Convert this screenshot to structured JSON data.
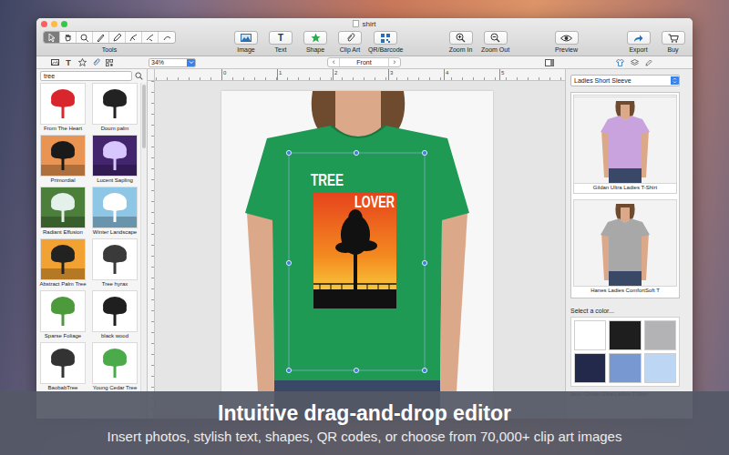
{
  "window": {
    "title": "shirt"
  },
  "toolbar": {
    "tools_label": "Tools",
    "tools": [
      {
        "selected": true
      },
      {
        "selected": false
      },
      {
        "selected": false
      },
      {
        "selected": false
      },
      {
        "selected": false
      },
      {
        "selected": false
      },
      {
        "selected": false
      },
      {
        "selected": false
      }
    ],
    "groups": [
      [
        {
          "label": "Image"
        },
        {
          "label": "Text",
          "glyph": "T"
        },
        {
          "label": "Shape"
        },
        {
          "label": "Clip Art"
        },
        {
          "label": "QR/Barcode"
        }
      ],
      [
        {
          "label": "Zoom In"
        },
        {
          "label": "Zoom Out"
        }
      ],
      [
        {
          "label": "Preview"
        }
      ],
      [
        {
          "label": "Export"
        },
        {
          "label": "Buy"
        }
      ]
    ]
  },
  "library_tabs": [
    {
      "selected": false
    },
    {
      "glyph": "T",
      "selected": false
    },
    {
      "selected": false
    },
    {
      "selected": true
    },
    {
      "selected": false
    }
  ],
  "zoom": {
    "value": "34%"
  },
  "side": {
    "prev": "‹",
    "label": "Front",
    "next": "›"
  },
  "right_tabs": [
    {
      "selected": true
    },
    {
      "selected": false
    },
    {
      "selected": false
    }
  ],
  "rulers": {
    "top": [
      "0",
      "1",
      "2",
      "3",
      "4",
      "5"
    ]
  },
  "library": {
    "search": "tree",
    "items": [
      {
        "label": "From The Heart",
        "selected": false
      },
      {
        "label": "Doum palm",
        "selected": false
      },
      {
        "label": "Primordial",
        "selected": false
      },
      {
        "label": "Lucent Sapling",
        "selected": false
      },
      {
        "label": "Radiant Effusion",
        "selected": false
      },
      {
        "label": "Winter Landscape",
        "selected": false
      },
      {
        "label": "Abstract Palm Tree",
        "selected": false
      },
      {
        "label": "Tree hyrax",
        "selected": false
      },
      {
        "label": "Sparse Foliage",
        "selected": false
      },
      {
        "label": "black wood",
        "selected": false
      },
      {
        "label": "BaobabTree",
        "selected": false
      },
      {
        "label": "Young Cedar Tree",
        "selected": false
      }
    ]
  },
  "design": {
    "texts": [
      "TREE",
      "LOVER"
    ]
  },
  "products": {
    "category": "Ladies Short Sleeve",
    "items": [
      {
        "label": "Gildan Ultra Ladies T-Shirt",
        "color": "#c9a3dd",
        "selected": true
      },
      {
        "label": "Hanes Ladies ComfortSoft T",
        "color": "#a8a8a8",
        "selected": false
      }
    ]
  },
  "colors": {
    "label": "Select a color...",
    "swatches": [
      {
        "color": "#ffffff",
        "selected": false
      },
      {
        "color": "#1e1e1e",
        "selected": false
      },
      {
        "color": "#b3b3b5",
        "selected": false
      },
      {
        "color": "#22294a",
        "selected": false
      },
      {
        "color": "#7898d2",
        "selected": false
      },
      {
        "color": "#bcd6f4",
        "selected": false
      }
    ]
  },
  "item": "Item: Gildan Ultra Ladies T-Shirt",
  "caption": {
    "title": "Intuitive drag-and-drop editor",
    "subtitle": "Insert photos, stylish text, shapes, QR codes, or choose from 70,000+ clip art images"
  }
}
